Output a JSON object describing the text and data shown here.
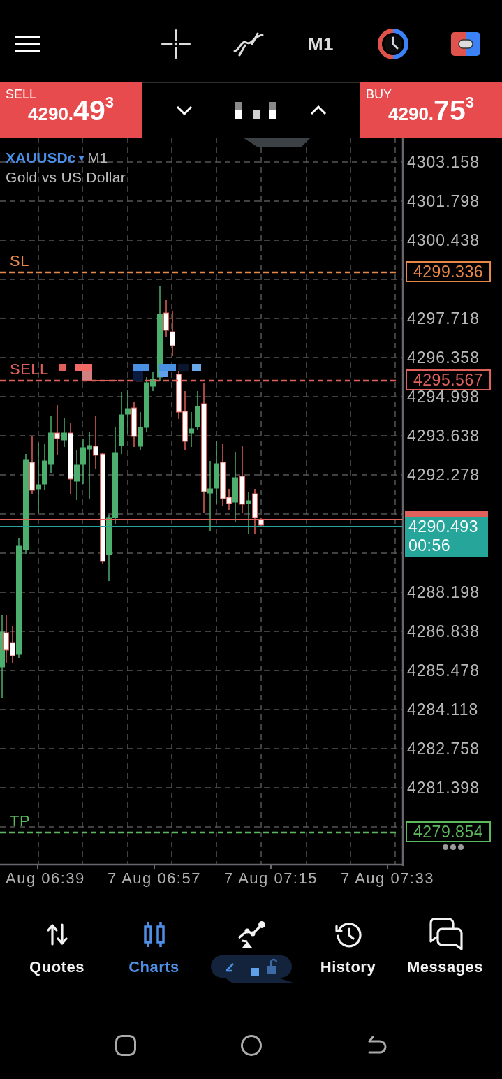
{
  "toolbar": {
    "timeframe": "M1"
  },
  "trade_panel": {
    "sell": {
      "label": "SELL",
      "price": "4290.**49**$^{3}$"
    },
    "buy": {
      "label": "BUY",
      "price": "4290.**75**$^{3}$"
    }
  },
  "chart": {
    "symbol": "XAUUSDc",
    "timeframe": "M1",
    "description": "Gold vs US Dollar",
    "price_axis": [
      "4303.158",
      "4301.798",
      "4300.438",
      "4297.718",
      "4296.358",
      "4294.998",
      "4293.638",
      "4292.278",
      "4288.198",
      "4286.838",
      "4285.478",
      "4284.118",
      "4282.758",
      "4281.398"
    ],
    "levels": [
      {
        "kind": "stop_loss",
        "label": "SL",
        "price": "4299.336"
      },
      {
        "kind": "order",
        "label": "SELL",
        "price": "4295.567"
      },
      {
        "kind": "take_profit",
        "label": "TP",
        "price": "4279.854"
      }
    ],
    "bid": {
      "price": "4290.493",
      "countdown": "00:56"
    },
    "time_axis": [
      "Aug 06:39",
      "7 Aug 06:57",
      "7 Aug 07:15",
      "7 Aug 07:33"
    ]
  },
  "bottom_nav": [
    {
      "kind": "quotes",
      "label": "Quotes",
      "selected": false
    },
    {
      "kind": "charts",
      "label": "Charts",
      "selected": true
    },
    {
      "kind": "trade",
      "selected": false
    },
    {
      "kind": "history",
      "label": "History",
      "selected": false
    },
    {
      "kind": "messages",
      "label": "Messages",
      "selected": false
    }
  ]
}
